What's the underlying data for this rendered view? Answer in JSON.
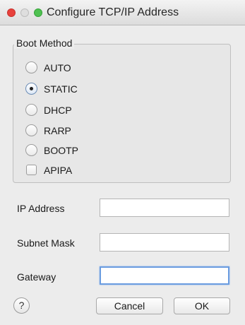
{
  "window": {
    "title": "Configure TCP/IP Address"
  },
  "boot_method": {
    "legend": "Boot Method",
    "options": [
      {
        "label": "AUTO",
        "type": "radio",
        "selected": false
      },
      {
        "label": "STATIC",
        "type": "radio",
        "selected": true
      },
      {
        "label": "DHCP",
        "type": "radio",
        "selected": false
      },
      {
        "label": "RARP",
        "type": "radio",
        "selected": false
      },
      {
        "label": "BOOTP",
        "type": "radio",
        "selected": false
      },
      {
        "label": "APIPA",
        "type": "checkbox",
        "checked": false
      }
    ]
  },
  "fields": {
    "ip_address": {
      "label": "IP Address",
      "value": ""
    },
    "subnet_mask": {
      "label": "Subnet Mask",
      "value": ""
    },
    "gateway": {
      "label": "Gateway",
      "value": "",
      "focused": true
    }
  },
  "buttons": {
    "help": "?",
    "cancel": "Cancel",
    "ok": "OK"
  }
}
